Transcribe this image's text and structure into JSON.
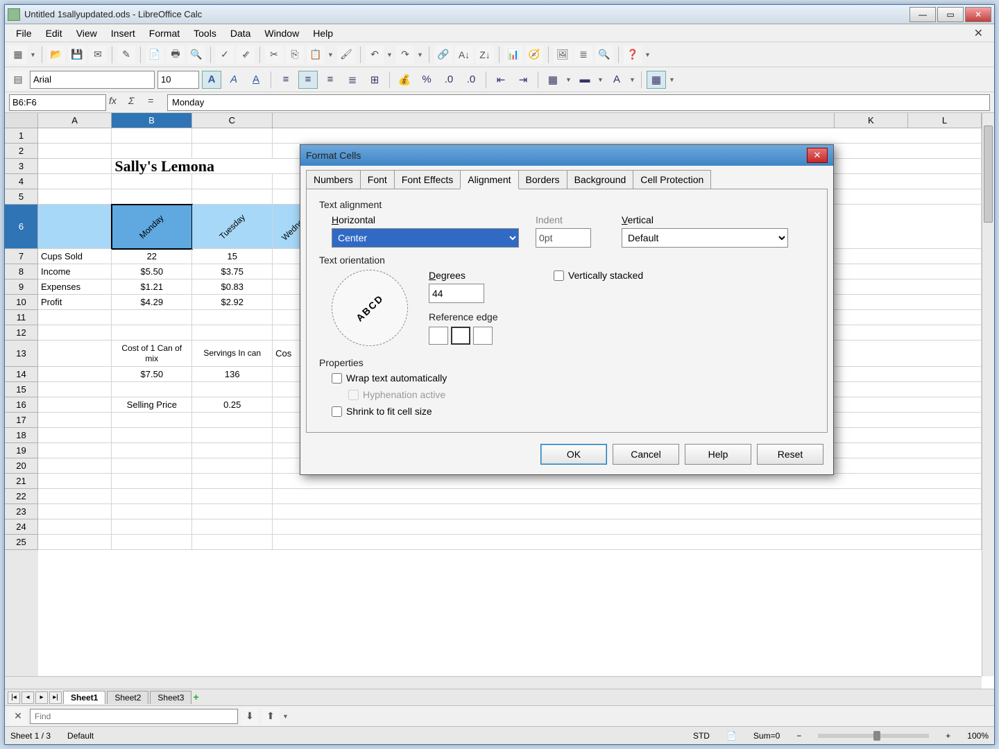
{
  "window": {
    "title": "Untitled 1sallyupdated.ods - LibreOffice Calc"
  },
  "menubar": [
    "File",
    "Edit",
    "View",
    "Insert",
    "Format",
    "Tools",
    "Data",
    "Window",
    "Help"
  ],
  "fmtbar": {
    "font_name": "Arial",
    "font_size": "10"
  },
  "formulabar": {
    "namebox": "B6:F6",
    "formula": "Monday"
  },
  "columns": [
    "A",
    "B",
    "C",
    "K",
    "L"
  ],
  "spreadsheet": {
    "title_text": "Sally's Lemona",
    "headers_row6": [
      "",
      "Monday",
      "Tuesday",
      "Wednesd"
    ],
    "rows": [
      {
        "r": "7",
        "a": "Cups Sold",
        "b": "22",
        "c": "15"
      },
      {
        "r": "8",
        "a": "Income",
        "b": "$5.50",
        "c": "$3.75"
      },
      {
        "r": "9",
        "a": "Expenses",
        "b": "$1.21",
        "c": "$0.83"
      },
      {
        "r": "10",
        "a": "Profit",
        "b": "$4.29",
        "c": "$2.92"
      }
    ],
    "block2": {
      "r13_b": "Cost of 1 Can of mix",
      "r13_c": "Servings In can",
      "r13_d": "Cos",
      "r14_b": "$7.50",
      "r14_c": "136",
      "r16_b": "Selling Price",
      "r16_c": "0.25"
    }
  },
  "tabs": {
    "sheets": [
      "Sheet1",
      "Sheet2",
      "Sheet3"
    ],
    "active": 0
  },
  "findbar": {
    "placeholder": "Find"
  },
  "statusbar": {
    "sheet_info": "Sheet 1 / 3",
    "style": "Default",
    "mode": "STD",
    "sum": "Sum=0",
    "zoom": "100%"
  },
  "dialog": {
    "title": "Format Cells",
    "tabs": [
      "Numbers",
      "Font",
      "Font Effects",
      "Alignment",
      "Borders",
      "Background",
      "Cell Protection"
    ],
    "active_tab": 3,
    "text_alignment_label": "Text alignment",
    "horizontal_label": "Horizontal",
    "horizontal_value": "Center",
    "indent_label": "Indent",
    "indent_value": "0pt",
    "vertical_label": "Vertical",
    "vertical_value": "Default",
    "orientation_label": "Text orientation",
    "degrees_label": "Degrees",
    "degrees_value": "44",
    "vert_stacked_label": "Vertically stacked",
    "ref_edge_label": "Reference edge",
    "dial_text": "ABCD",
    "properties_label": "Properties",
    "wrap_label": "Wrap text automatically",
    "hyph_label": "Hyphenation active",
    "shrink_label": "Shrink to fit cell size",
    "buttons": {
      "ok": "OK",
      "cancel": "Cancel",
      "help": "Help",
      "reset": "Reset"
    }
  }
}
